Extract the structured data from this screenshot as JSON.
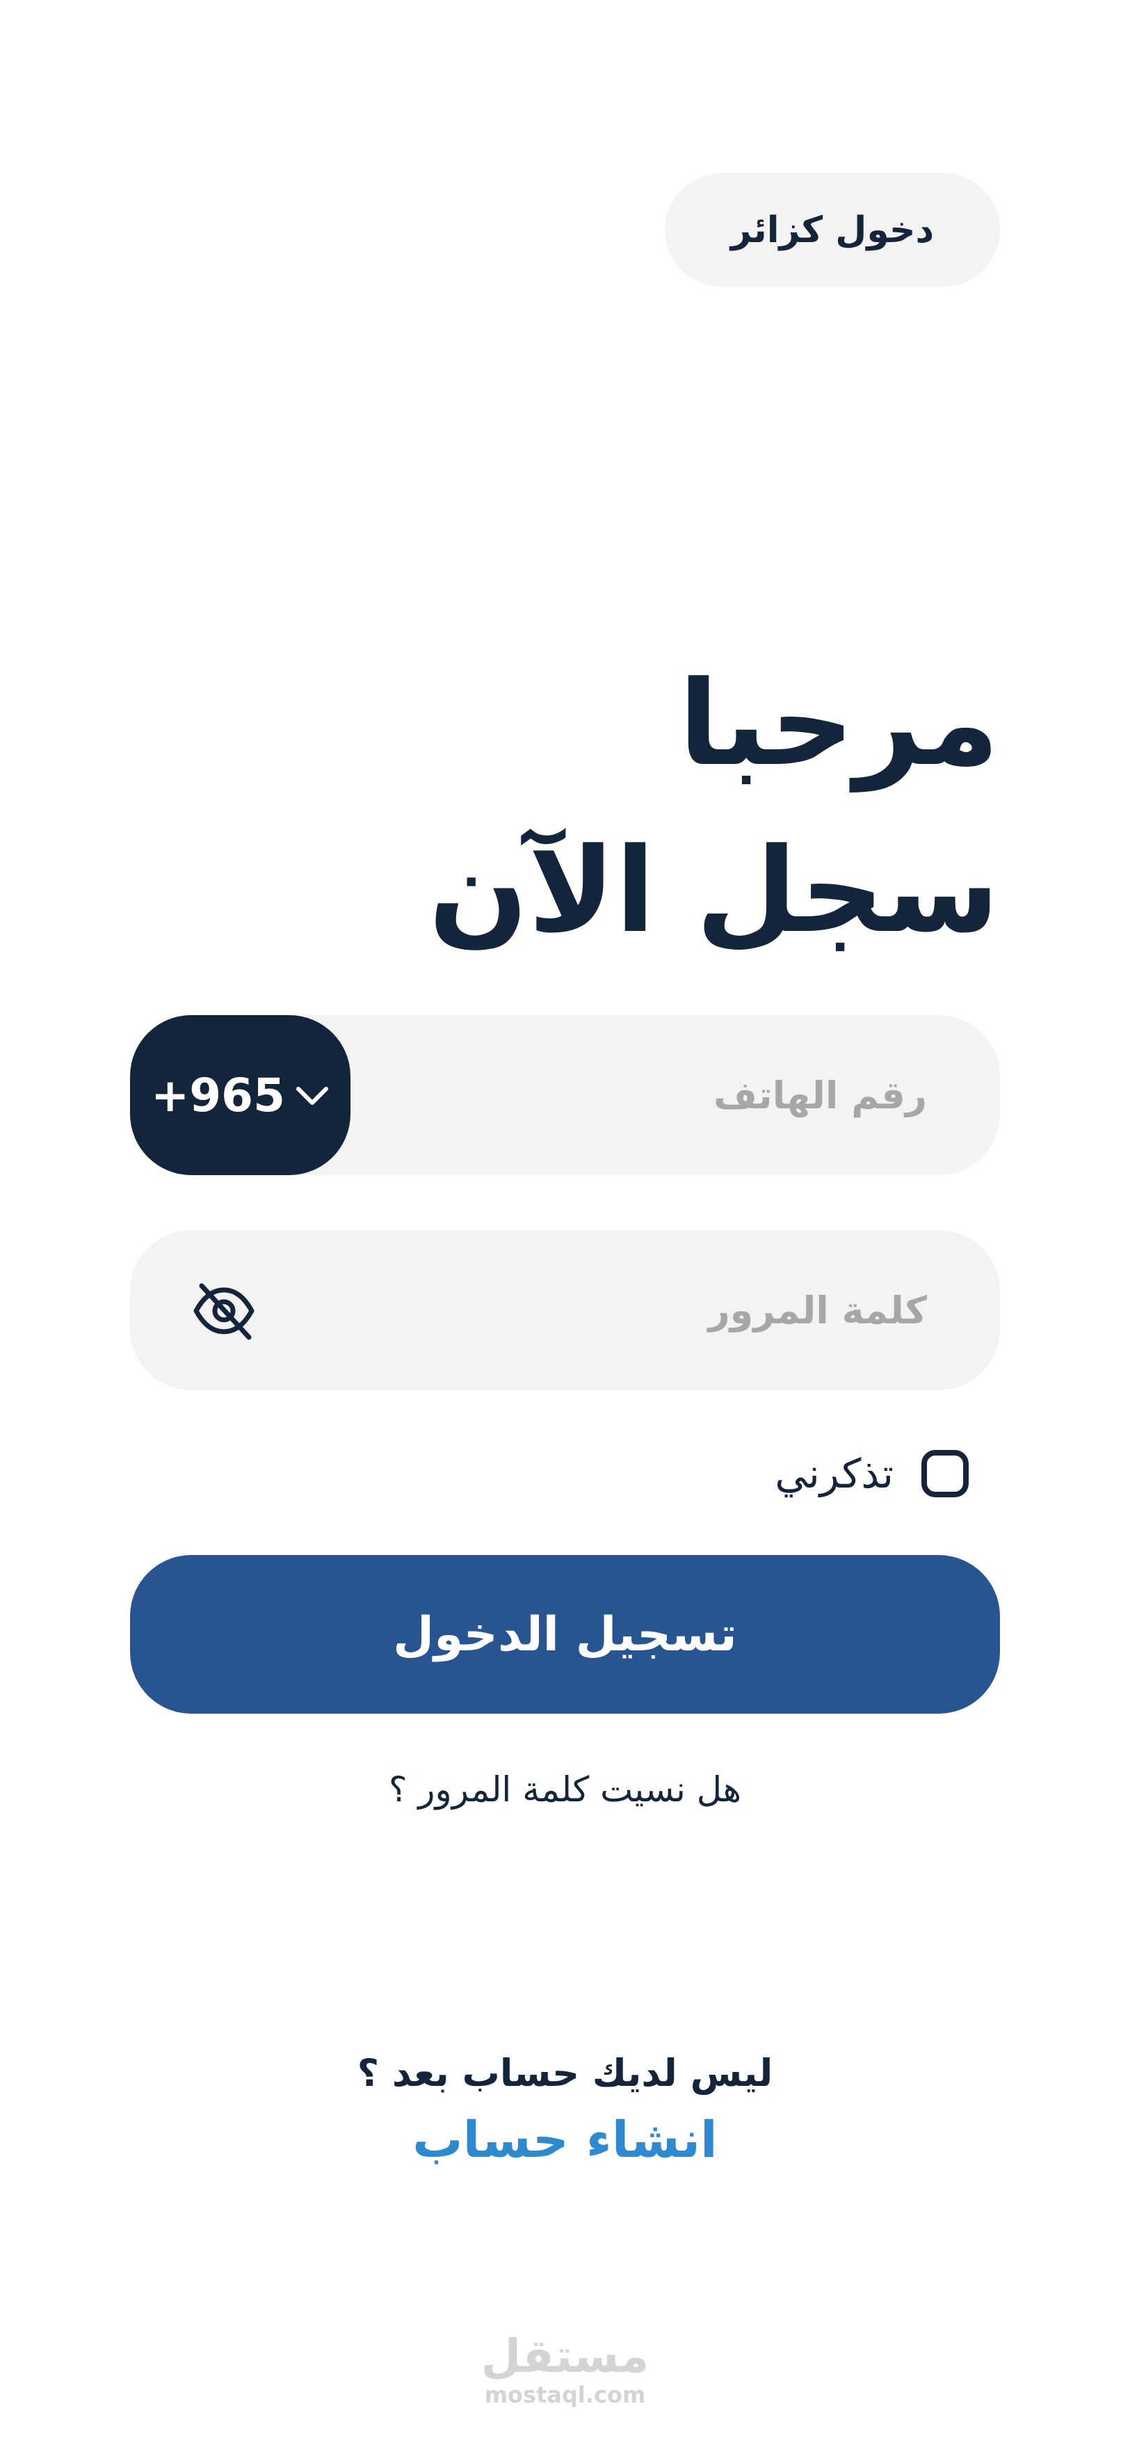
{
  "header": {
    "guest_login_label": "دخول كزائر"
  },
  "hero": {
    "line1": "مرحبا",
    "line2": "سجل الآن"
  },
  "form": {
    "phone": {
      "placeholder": "رقم الهاتف",
      "country_code": "+965"
    },
    "password": {
      "placeholder": "كلمة المرور"
    },
    "remember_me_label": "تذكرني",
    "login_button_label": "تسجيل الدخول",
    "forgot_password_label": "هل نسيت كلمة المرور ؟"
  },
  "footer": {
    "no_account_text": "ليس لديك حساب بعد ؟",
    "create_account_label": "انشاء حساب"
  },
  "watermark": {
    "arabic": "مستقل",
    "latin": "mostaql.com"
  },
  "icons": {
    "dropdown": "chevron-down-icon",
    "password_toggle": "eye-off-icon"
  },
  "colors": {
    "navy": "#14243a",
    "primary_button": "#285592",
    "link": "#2e8ad0",
    "field_background": "#f3f3f3",
    "placeholder": "#a7a7a7"
  }
}
